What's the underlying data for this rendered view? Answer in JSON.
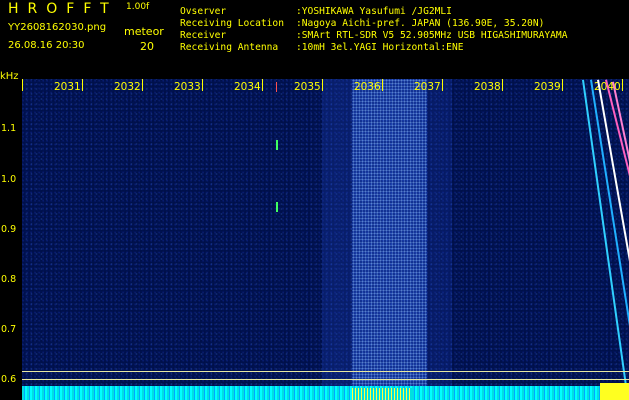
{
  "header": {
    "title": "HROFFT",
    "version": "1.00f",
    "filename": "YY2608162030.png",
    "datetime": "26.08.16 20:30",
    "meteor_label": "meteor",
    "meteor_count": "20",
    "info": [
      {
        "key": "Ovserver",
        "value": ":YOSHIKAWA Yasufumi /JG2MLI"
      },
      {
        "key": "Receiving Location",
        "value": ":Nagoya Aichi-pref. JAPAN (136.90E, 35.20N)"
      },
      {
        "key": "Receiver",
        "value": ":SMArt RTL-SDR V5 52.905MHz USB HIGASHIMURAYAMA"
      },
      {
        "key": "Receiving Antenna",
        "value": ":10mH 3el.YAGI Horizontal:ENE"
      }
    ]
  },
  "y_axis": {
    "unit": "kHz",
    "labels": [
      "1.1",
      "1.0",
      "0.9",
      "0.8",
      "0.7",
      "0.6"
    ]
  },
  "x_axis": {
    "labels": [
      "2031",
      "2032",
      "2033",
      "2034",
      "2035",
      "2036",
      "2037",
      "2038",
      "2039",
      "2040"
    ]
  },
  "colors": {
    "text": "#ffff00",
    "background": "#000000",
    "spectrum": "#00104a",
    "noise_band": "#3a70ff",
    "baseline": "#00e0e0",
    "streak_cyan": "#40e0ff",
    "streak_pink": "#ff60c0"
  }
}
